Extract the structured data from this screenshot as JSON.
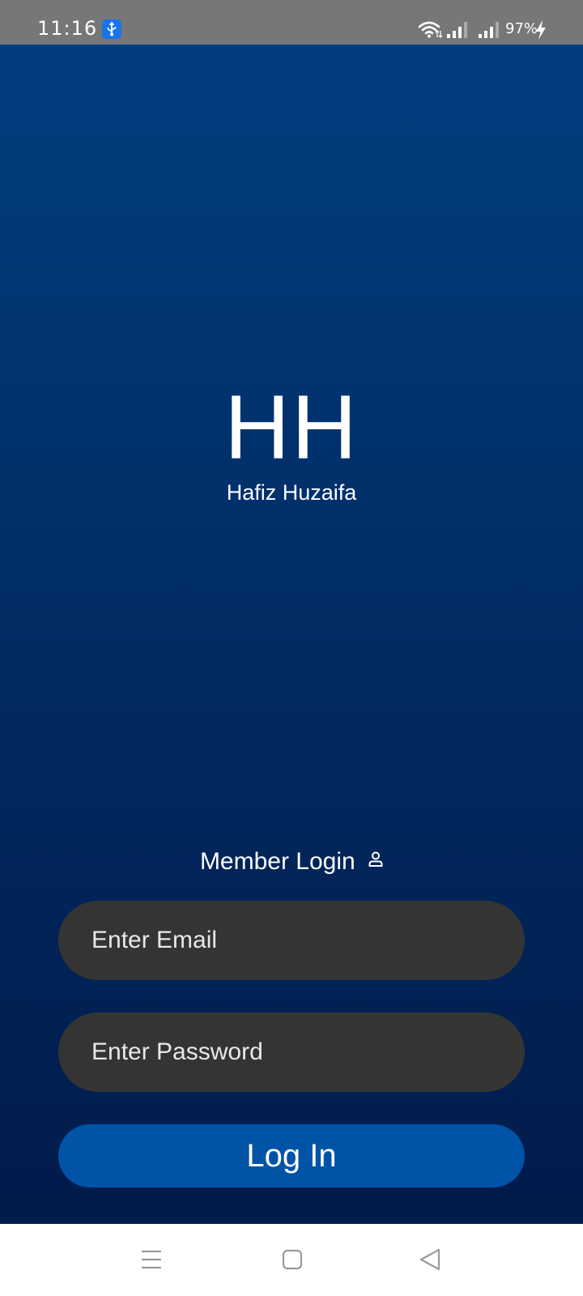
{
  "status_bar": {
    "time": "11:16",
    "battery": "97%",
    "icons": [
      "usb-icon",
      "wifi-icon",
      "signal-icon",
      "signal-icon",
      "charging-bolt-icon"
    ]
  },
  "branding": {
    "logo_text": "HH",
    "name": "Hafiz Huzaifa"
  },
  "login": {
    "heading": "Member Login",
    "heading_icon": "person-icon",
    "email_placeholder": "Enter Email",
    "password_placeholder": "Enter Password",
    "button_label": "Log In"
  },
  "nav_bar": {
    "buttons": [
      "menu-icon",
      "home-icon",
      "back-icon"
    ]
  },
  "colors": {
    "background_top": "#023e7f",
    "background_bottom": "#011b4a",
    "field_background": "#343532",
    "button_background": "#0053a6",
    "status_bar": "#777777"
  }
}
